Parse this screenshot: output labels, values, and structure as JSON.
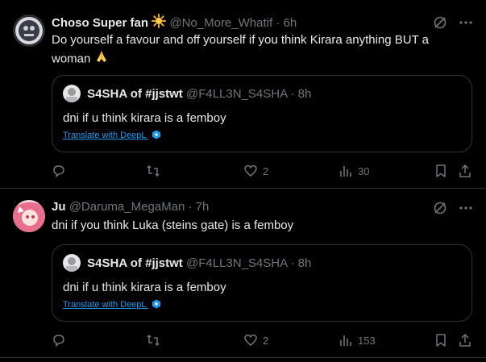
{
  "tweets": [
    {
      "author_name": "Choso Super fan",
      "handle": "@No_More_Whatif",
      "separator": "·",
      "time": "6h",
      "text": "Do yourself a favour and off yourself if you think Kirara anything BUT a woman",
      "name_emoji": "sun-emoji",
      "text_emoji": "folded-hands-emoji",
      "quote": {
        "author_name": "S4SHA of #jjstwt",
        "handle": "@F4LL3N_S4SHA",
        "separator": "·",
        "time": "8h",
        "text": "dni if u think kirara is a femboy",
        "translate": "Translate with DeepL"
      },
      "stats": {
        "replies": "",
        "reposts": "",
        "likes": "2",
        "views": "30"
      }
    },
    {
      "author_name": "Ju",
      "handle": "@Daruma_MegaMan",
      "separator": "·",
      "time": "7h",
      "text": "dni if you think Luka (steins gate) is a femboy",
      "quote": {
        "author_name": "S4SHA of #jjstwt",
        "handle": "@F4LL3N_S4SHA",
        "separator": "·",
        "time": "8h",
        "text": "dni if u think kirara is a femboy",
        "translate": "Translate with DeepL"
      },
      "stats": {
        "replies": "",
        "reposts": "",
        "likes": "2",
        "views": "153"
      }
    }
  ],
  "colors": {
    "background": "#000000",
    "text": "#e7e9ea",
    "muted": "#71767b",
    "link": "#1d9bf0",
    "border": "#2f3336"
  }
}
